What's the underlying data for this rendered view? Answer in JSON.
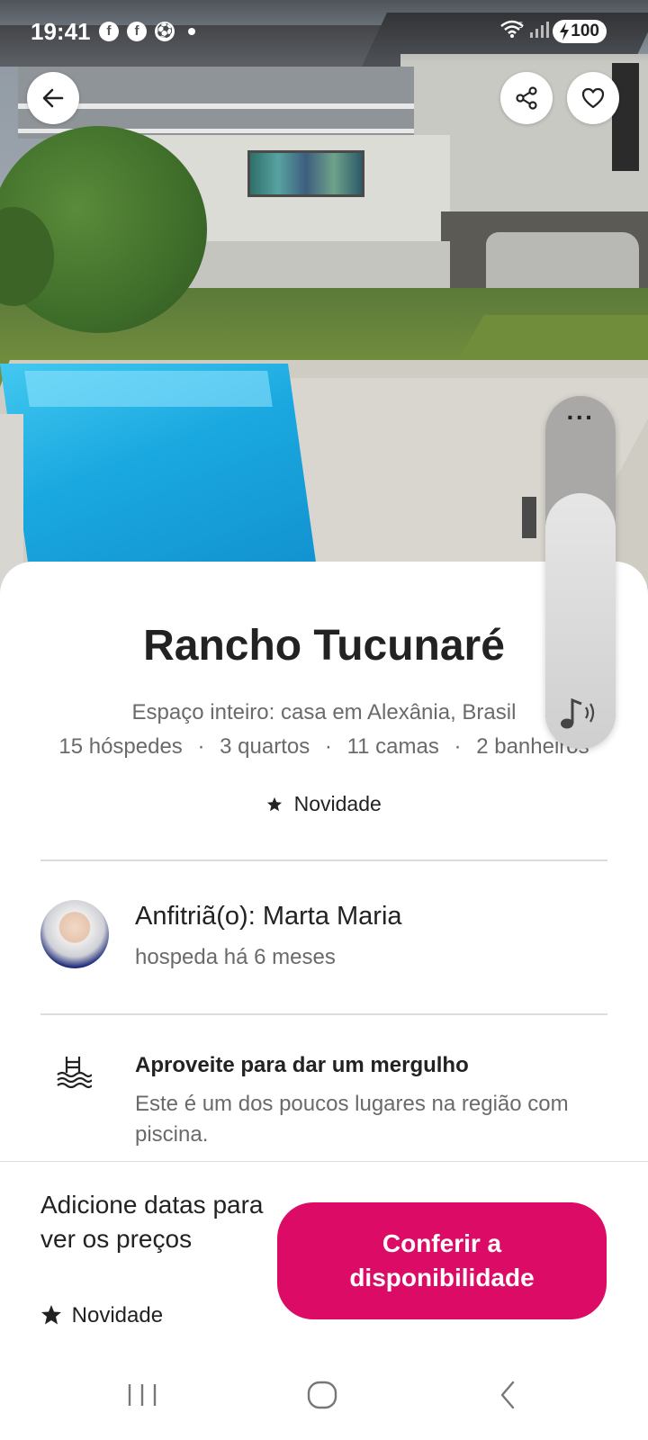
{
  "status_bar": {
    "time": "19:41",
    "notification_icons": [
      "facebook-icon",
      "facebook-icon",
      "soccer-ball-icon"
    ],
    "wifi_label": "5",
    "battery_level": "100"
  },
  "listing": {
    "title": "Rancho Tucunaré",
    "subtitle": "Espaço inteiro: casa em Alexânia, Brasil",
    "details": {
      "guests": "15 hóspedes",
      "bedrooms": "3 quartos",
      "beds": "11 camas",
      "bathrooms": "2 banheiros",
      "separator": "·"
    },
    "badge": "Novidade"
  },
  "host": {
    "name_label": "Anfitriã(o): Marta Maria",
    "since": "hospeda há 6 meses"
  },
  "feature": {
    "icon": "pool-icon",
    "title": "Aproveite para dar um mergulho",
    "description": "Este é um dos poucos lugares na região com piscina."
  },
  "footer": {
    "price_hint": "Adicione datas para ver os preços",
    "badge": "Novidade",
    "cta_label": "Conferir a disponibilidade"
  },
  "colors": {
    "accent": "#dc0c66",
    "text_primary": "#222222",
    "text_secondary": "#6a6a6a",
    "divider": "#dddddd"
  },
  "volume_panel": {
    "more_label": "···"
  }
}
